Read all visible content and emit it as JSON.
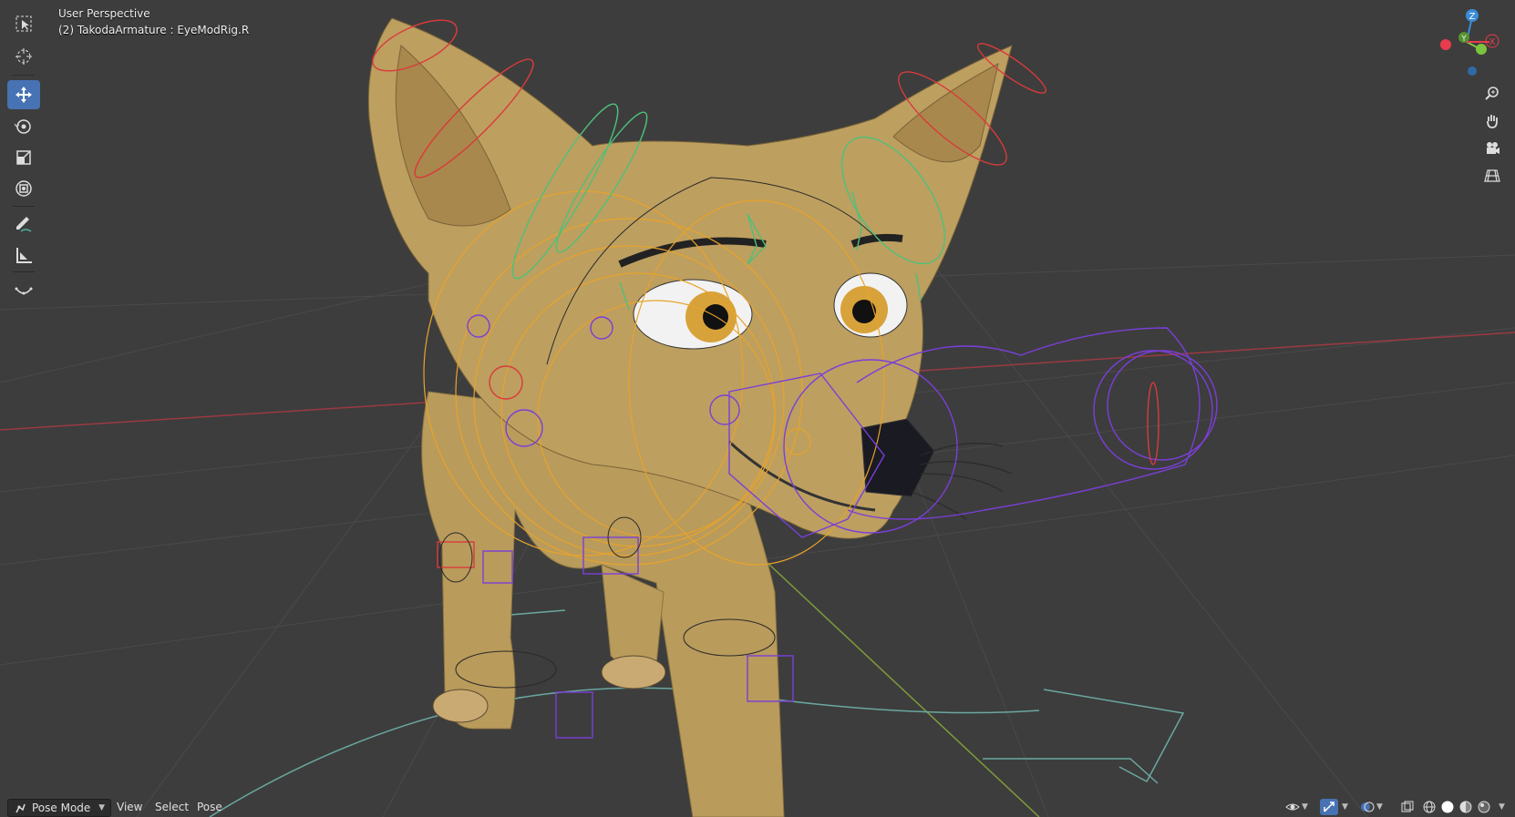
{
  "viewport": {
    "view_name": "User Perspective",
    "object_info": "(2) TakodaArmature : EyeModRig.R"
  },
  "toolbar": {
    "tools": [
      {
        "name": "select-box-icon",
        "active": false
      },
      {
        "name": "cursor-icon",
        "active": false
      },
      {
        "name": "move-icon",
        "active": true
      },
      {
        "name": "rotate-icon",
        "active": false
      },
      {
        "name": "scale-icon",
        "active": false
      },
      {
        "name": "transform-icon",
        "active": false
      },
      {
        "name": "annotate-icon",
        "active": false
      },
      {
        "name": "measure-icon",
        "active": false
      },
      {
        "name": "relax-pose-icon",
        "active": false
      }
    ]
  },
  "gizmo": {
    "axes": {
      "x": "X",
      "y": "Y",
      "z": "Z"
    },
    "colors": {
      "x": "#e83b4c",
      "y": "#7dc43e",
      "z": "#3b8cd8"
    }
  },
  "nav_buttons": [
    "zoom-icon",
    "pan-hand-icon",
    "camera-icon",
    "ortho-grid-icon"
  ],
  "header": {
    "mode": "Pose Mode",
    "menus": [
      "View",
      "Select",
      "Pose"
    ]
  },
  "colors": {
    "background": "#3d3d3d",
    "active_tool": "#4772b3",
    "model_tan": "#b99b5c",
    "bone_orange": "#e8a32a",
    "bone_purple": "#7a3fd8",
    "bone_red": "#d93b3b",
    "bone_green": "#4fc07a"
  }
}
